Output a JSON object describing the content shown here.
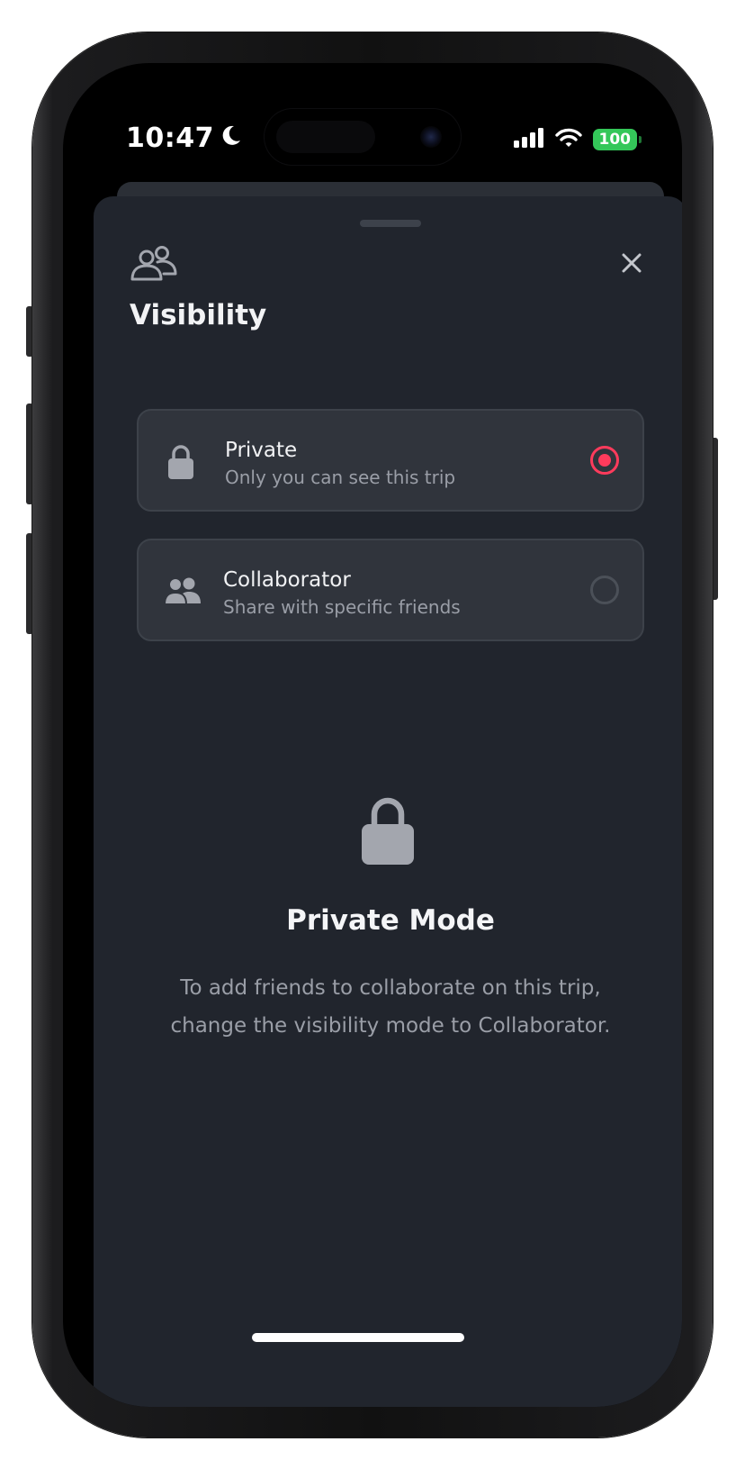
{
  "status_bar": {
    "time": "10:47",
    "battery": "100",
    "icons": [
      "moon-icon",
      "cellular-signal-icon",
      "wifi-icon",
      "battery-icon"
    ]
  },
  "sheet": {
    "header_icon": "people-outline-icon",
    "title": "Visibility",
    "close_icon": "close-icon"
  },
  "options": [
    {
      "label": "Private",
      "description": "Only you can see this trip",
      "icon": "lock-icon",
      "selected": true
    },
    {
      "label": "Collaborator",
      "description": "Share with specific friends",
      "icon": "people-icon",
      "selected": false
    }
  ],
  "empty_state": {
    "icon": "lock-icon",
    "title": "Private Mode",
    "description": "To add friends to collaborate on this trip, change the visibility mode to Collaborator."
  },
  "colors": {
    "sheet_background": "#21252d",
    "accent": "#ff3b5c",
    "battery": "#34c759"
  }
}
